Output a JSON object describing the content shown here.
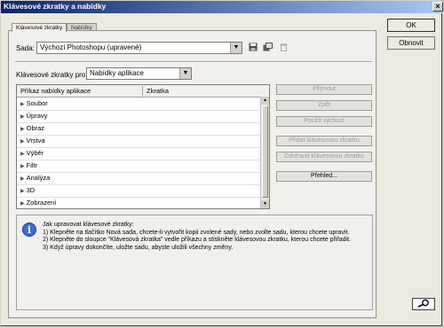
{
  "window": {
    "title": "Klávesové zkratky a nabídky"
  },
  "tabs": [
    {
      "label": "Klávesové zkratky"
    },
    {
      "label": "Nabídky"
    }
  ],
  "sada": {
    "label": "Sada:",
    "value": "Výchozí Photoshopu (upravené)"
  },
  "zkratky_pro": {
    "label": "Klávesové zkratky pro:",
    "value": "Nabídky aplikace"
  },
  "table": {
    "headers": [
      "Příkaz nabídky aplikace",
      "Zkratka"
    ],
    "rows": [
      "Soubor",
      "Úpravy",
      "Obraz",
      "Vrstva",
      "Výběr",
      "Filtr",
      "Analýza",
      "3D",
      "Zobrazení"
    ]
  },
  "side_buttons": {
    "prijmout": "Přijmout",
    "zpet": "Zpět",
    "pouzit_vychozi": "Použít výchozí",
    "pridat": "Přidat klávesovou zkratku",
    "odstranit": "Odstranit klávesovou zkratku",
    "prehled": "Přehled..."
  },
  "dialog_buttons": {
    "ok": "OK",
    "obnovit": "Obnovit"
  },
  "info": {
    "lines": [
      "Jak upravovat klávesové zkratky:",
      "1) Klepněte na tlačítko Nová sada, chcete-li vytvořit kopii zvolené sady, nebo zvolte sadu, kterou chcete upravit.",
      "2) Klepněte do sloupce \"Klávesová zkratka\" vedle příkazu a stiskněte klávesovou zkratku, kterou chcete přiřadit.",
      "3) Když úpravy dokončíte, uložte sadu, abyste uložili všechny změny."
    ]
  },
  "icons": {
    "save": "save-icon",
    "new_set": "new-set-icon",
    "delete": "trash-icon",
    "info": "info-icon",
    "zoom": "magnifier-icon"
  }
}
